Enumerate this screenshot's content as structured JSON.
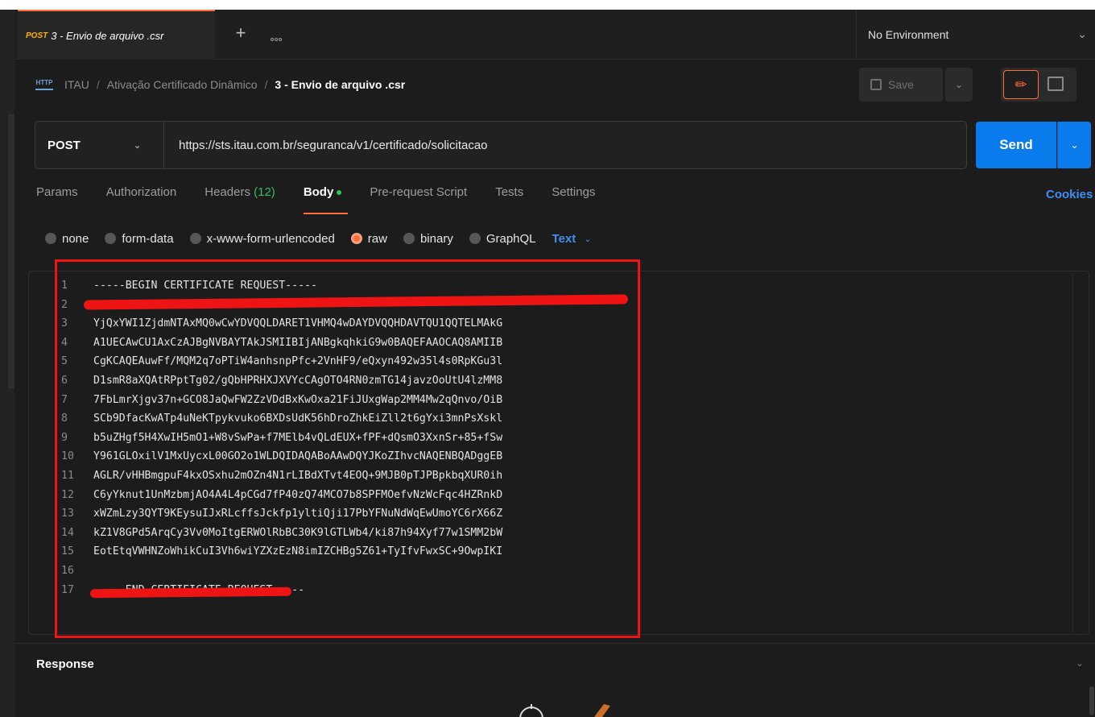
{
  "tab": {
    "method": "POST",
    "name": "3 - Envio de arquivo .csr"
  },
  "environment": {
    "label": "No Environment"
  },
  "breadcrumb": {
    "badge": "HTTP",
    "parts": [
      "ITAU",
      "Ativação Certificado Dinâmico"
    ],
    "separator": "/",
    "current": "3 - Envio de arquivo .csr"
  },
  "actions": {
    "save_label": "Save"
  },
  "request": {
    "method": "POST",
    "url": "https://sts.itau.com.br/seguranca/v1/certificado/solicitacao",
    "send_label": "Send"
  },
  "request_tabs": {
    "params": "Params",
    "authorization": "Authorization",
    "headers": "Headers",
    "headers_count": "(12)",
    "body": "Body",
    "pre_request": "Pre-request Script",
    "tests": "Tests",
    "settings": "Settings",
    "cookies": "Cookies"
  },
  "body_types": {
    "none": "none",
    "form_data": "form-data",
    "urlencoded": "x-www-form-urlencoded",
    "raw": "raw",
    "binary": "binary",
    "graphql": "GraphQL",
    "selected_format": "Text"
  },
  "editor": {
    "lines": [
      {
        "n": "1",
        "text": "-----BEGIN CERTIFICATE REQUEST-----"
      },
      {
        "n": "2",
        "text": ""
      },
      {
        "n": "3",
        "text": "YjQxYWI1ZjdmNTAxMQ0wCwYDVQQLDARET1VHMQ4wDAYDVQQHDAVTQU1QQTELMAkG"
      },
      {
        "n": "4",
        "text": "A1UECAwCU1AxCzAJBgNVBAYTAkJSMIIBIjANBgkqhkiG9w0BAQEFAAOCAQ8AMIIB"
      },
      {
        "n": "5",
        "text": "CgKCAQEAuwFf/MQM2q7oPTiW4anhsnpPfc+2VnHF9/eQxyn492w35l4s0RpKGu3l"
      },
      {
        "n": "6",
        "text": "D1smR8aXQAtRPptTg02/gQbHPRHXJXVYcCAgOTO4RN0zmTG14javzOoUtU4lzMM8"
      },
      {
        "n": "7",
        "text": "7FbLmrXjgv37n+GCO8JaQwFW2ZzVDdBxKwOxa21FiJUxgWap2MM4Mw2qQnvo/OiB"
      },
      {
        "n": "8",
        "text": "SCb9DfacKwATp4uNeKTpykvuko6BXDsUdK56hDroZhkEiZll2t6gYxi3mnPsXskl"
      },
      {
        "n": "9",
        "text": "b5uZHgf5H4XwIH5mO1+W8vSwPa+f7MElb4vQLdEUX+fPF+dQsmO3XxnSr+85+fSw"
      },
      {
        "n": "10",
        "text": "Y961GLOxilV1MxUycxL00GO2o1WLDQIDAQABoAAwDQYJKoZIhvcNAQENBQADggEB"
      },
      {
        "n": "11",
        "text": "AGLR/vHHBmgpuF4kxOSxhu2mOZn4N1rLIBdXTvt4EOQ+9MJB0pTJPBpkbqXUR0ih"
      },
      {
        "n": "12",
        "text": "C6yYknut1UnMzbmjAO4A4L4pCGd7fP40zQ74MCO7b8SPFMOefvNzWcFqc4HZRnkD"
      },
      {
        "n": "13",
        "text": "xWZmLzy3QYT9KEysuIJxRLcffsJckfp1yltiQji17PbYFNuNdWqEwUmoYC6rX66Z"
      },
      {
        "n": "14",
        "text": "kZ1V8GPd5ArqCy3Vv0MoItgERWOlRbBC30K9lGTLWb4/ki87h94Xyf77w1SMM2bW"
      },
      {
        "n": "15",
        "text": "EotEtqVWHNZoWhikCuI3Vh6wiYZXzEzN8imIZCHBg5Z61+TyIfvFwxSC+9OwpIKI"
      },
      {
        "n": "16",
        "text": ""
      },
      {
        "n": "17",
        "text": "-----END CERTIFICATE REQUEST-----"
      }
    ]
  },
  "response": {
    "label": "Response"
  },
  "colors": {
    "accent": "#ff6c37",
    "send": "#097bed",
    "link": "#3f8ef0",
    "status_green": "#30c060",
    "annotation_red": "#ee1414"
  }
}
